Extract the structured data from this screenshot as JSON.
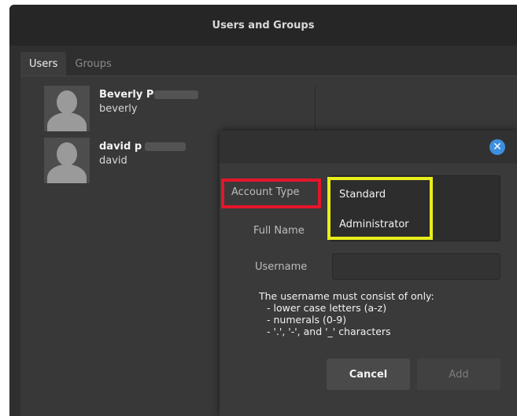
{
  "window": {
    "title": "Users and Groups"
  },
  "tabs": [
    {
      "label": "Users",
      "active": true
    },
    {
      "label": "Groups",
      "active": false
    }
  ],
  "users": [
    {
      "display_name": "Beverly P",
      "login": "beverly"
    },
    {
      "display_name": "david p",
      "login": "david"
    }
  ],
  "dialog": {
    "labels": {
      "account_type": "Account Type",
      "full_name": "Full Name",
      "username": "Username"
    },
    "account_type_options": [
      "Standard",
      "Administrator"
    ],
    "username_value": "",
    "help_text": {
      "heading": "The username must consist of only:",
      "rules": [
        "- lower case letters (a-z)",
        "- numerals (0-9)",
        "- '.', '-', and '_' characters"
      ]
    },
    "buttons": {
      "cancel": "Cancel",
      "add": "Add"
    }
  },
  "colors": {
    "highlight_red": "#e5152b",
    "highlight_yellow": "#e8ef1a",
    "close_button": "#3d8fe0"
  }
}
